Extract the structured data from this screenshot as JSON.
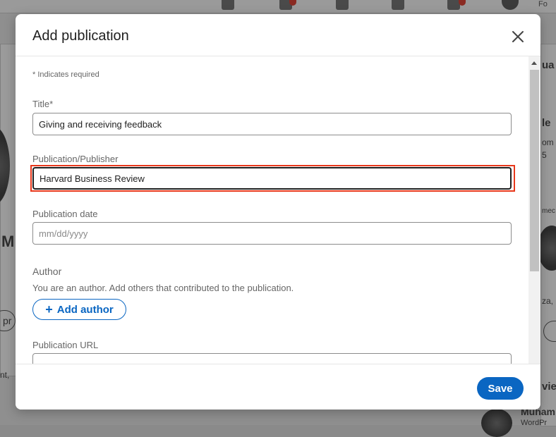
{
  "background": {
    "nav_label": "Fo",
    "initial": "M",
    "left_snippet": "pr",
    "left_snippet_2": "nt, ",
    "right_snippets": [
      "ua",
      "le",
      "om",
      "5",
      "mec",
      "za, C",
      "vie",
      "Muham",
      "WordPr"
    ]
  },
  "modal": {
    "title": "Add publication",
    "close_icon": "close-icon",
    "required_note": "* Indicates required",
    "fields": {
      "title": {
        "label": "Title*",
        "value": "Giving and receiving feedback"
      },
      "publisher": {
        "label": "Publication/Publisher",
        "value": "Harvard Business Review"
      },
      "date": {
        "label": "Publication date",
        "placeholder": "mm/dd/yyyy"
      },
      "author": {
        "label": "Author",
        "helper": "You are an author. Add others that contributed to the publication.",
        "button_label": "Add author"
      },
      "url": {
        "label": "Publication URL",
        "value": ""
      }
    },
    "footer": {
      "save_label": "Save"
    }
  },
  "colors": {
    "accent": "#0a66c2",
    "focus_highlight": "#e8371b"
  }
}
